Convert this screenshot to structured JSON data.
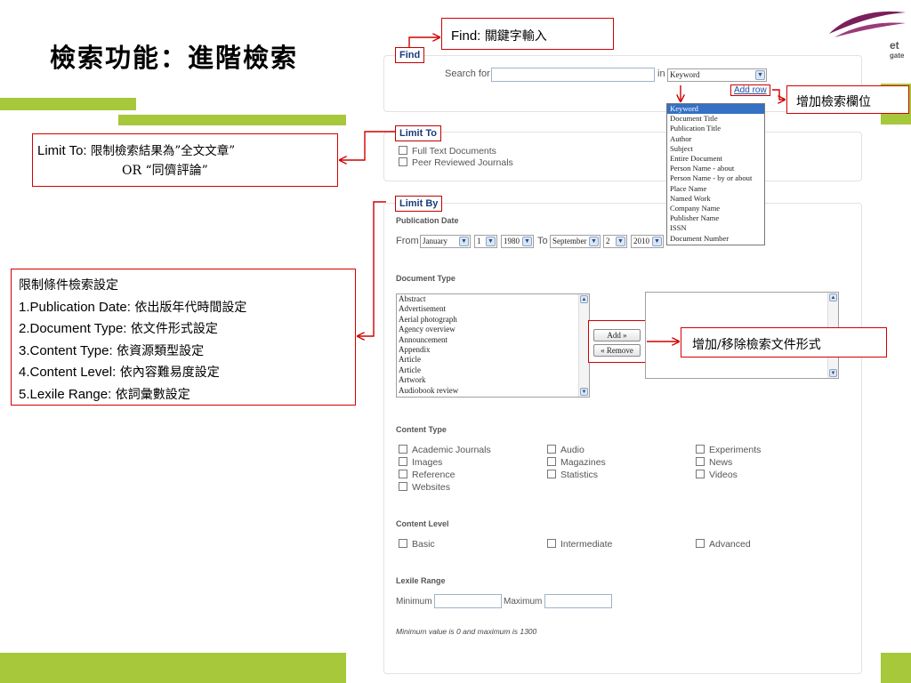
{
  "slide": {
    "title": "檢索功能：進階檢索",
    "logo_text_top": "et",
    "logo_text_bottom": "gate",
    "colors": {
      "accent_green": "#a6c83a",
      "annotation_red": "#d00000",
      "logo_purple": "#7a1f5c",
      "highlight_blue": "#3470c4"
    }
  },
  "annotations": {
    "find": {
      "label": "Find:",
      "text": "關鍵字輸入"
    },
    "add_field": "增加檢索欄位",
    "limit_to": {
      "label": "Limit To:",
      "line1": "限制檢索結果為”全文文章”",
      "line2": "OR “同儕評論”"
    },
    "limit_by": {
      "line0": "限制條件檢索設定",
      "items": [
        {
          "num": "1.Publication Date:",
          "desc": "依出版年代時間設定"
        },
        {
          "num": "2.Document Type:",
          "desc": "依文件形式設定"
        },
        {
          "num": "3.Content Type:",
          "desc": "依資源類型設定"
        },
        {
          "num": "4.Content Level:",
          "desc": "依內容難易度設定"
        },
        {
          "num": "5.Lexile Range:",
          "desc": "依詞彙數設定"
        }
      ]
    },
    "doc_type": "增加/移除檢索文件形式"
  },
  "find": {
    "tab": "Find",
    "search_for_label": "Search for",
    "search_value": "",
    "in_label": "in",
    "field_selected": "Keyword",
    "add_row": "Add row",
    "field_options": [
      "Keyword",
      "Document Title",
      "Publication Title",
      "Author",
      "Subject",
      "Entire Document",
      "Person Name - about",
      "Person Name - by or about",
      "Place Name",
      "Named Work",
      "Company Name",
      "Publisher Name",
      "ISSN",
      "Document Number"
    ]
  },
  "limit_to": {
    "tab": "Limit To",
    "options": [
      {
        "label": "Full Text Documents",
        "checked": false
      },
      {
        "label": "Peer Reviewed Journals",
        "checked": false
      }
    ]
  },
  "limit_by": {
    "tab": "Limit By",
    "pub_date": {
      "heading": "Publication Date",
      "from_label": "From",
      "from_month": "January",
      "from_day": "1",
      "from_year": "1980",
      "to_label": "To",
      "to_month": "September",
      "to_day": "2",
      "to_year": "2010"
    },
    "doc_type": {
      "heading": "Document Type",
      "items": [
        "Abstract",
        "Advertisement",
        "Aerial photograph",
        "Agency overview",
        "Announcement",
        "Appendix",
        "Article",
        "Article",
        "Artwork",
        "Audiobook review"
      ],
      "add_btn": "Add »",
      "remove_btn": "« Remove"
    },
    "content_type": {
      "heading": "Content Type",
      "col1": [
        "Academic Journals",
        "Images",
        "Reference",
        "Websites"
      ],
      "col2": [
        "Audio",
        "Magazines",
        "Statistics"
      ],
      "col3": [
        "Experiments",
        "News",
        "Videos"
      ]
    },
    "content_level": {
      "heading": "Content Level",
      "options": [
        "Basic",
        "Intermediate",
        "Advanced"
      ]
    },
    "lexile": {
      "heading": "Lexile Range",
      "min_label": "Minimum",
      "min_value": "",
      "max_label": "Maximum",
      "max_value": "",
      "note": "Minimum value is 0 and maximum is 1300"
    }
  }
}
